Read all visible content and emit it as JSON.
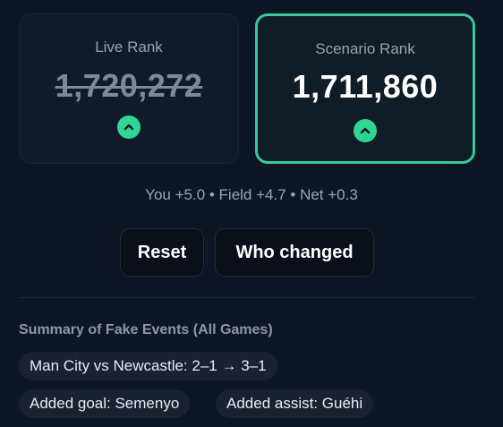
{
  "live": {
    "label": "Live Rank",
    "value": "1,720,272",
    "trend_icon": "chevron-up-icon"
  },
  "scenario": {
    "label": "Scenario Rank",
    "value": "1,711,860",
    "trend_icon": "chevron-up-icon"
  },
  "net_summary": "You +5.0 • Field +4.7 • Net +0.3",
  "buttons": {
    "reset": "Reset",
    "who_changed": "Who changed"
  },
  "summary": {
    "title": "Summary of Fake Events (All Games)",
    "items": [
      "Man City vs Newcastle: 2–1 → 3–1",
      "Added goal: Semenyo",
      "Added assist: Guéhi"
    ]
  },
  "colors": {
    "background": "#0e1525",
    "accent": "#37c99a",
    "trend_up": "#2fd693"
  }
}
